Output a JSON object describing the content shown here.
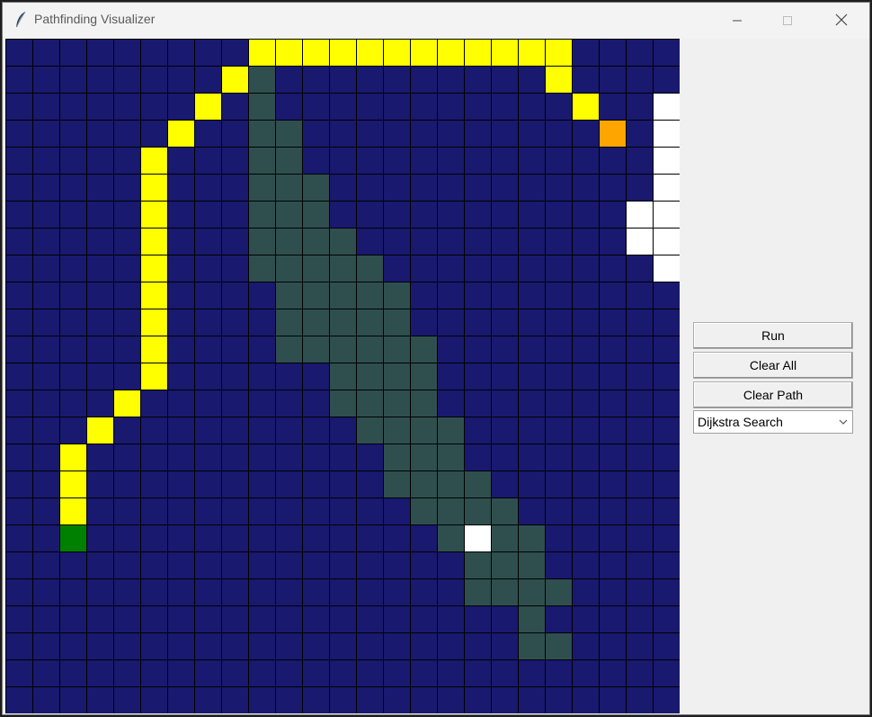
{
  "window": {
    "title": "Pathfinding Visualizer"
  },
  "controls": {
    "run_label": "Run",
    "clear_all_label": "Clear All",
    "clear_path_label": "Clear Path",
    "algorithm_selected": "Dijkstra Search",
    "icons": [
      "feather-icon",
      "minimize-icon",
      "maximize-icon",
      "close-icon",
      "chevron-down-icon"
    ]
  },
  "colors": {
    "empty": "#191970",
    "path": "#ffff00",
    "explored": "#2f4f4f",
    "wall": "#ffffff",
    "start": "#008000",
    "end": "#ffa500",
    "grid_line": "#000000"
  },
  "grid": {
    "rows": 25,
    "cols": 25,
    "cells": [
      "000000000yyyyyyyyyyyy0000",
      "00000000yx0000000000y0000",
      "0000000y0x00000000000y00w",
      "000000y00xx0000000000000w",
      "00000y000xx0000000000000ww",
      "00000y000xxx000000000000ww",
      "00000y000xxx00000000000www",
      "00000y000xxxx0000000000www",
      "00000y000xxxxx0000000000w",
      "00000y0000xxxxx0000000000",
      "00000y0000xxxxx0000000000",
      "00000y0000xxxxxx000000000",
      "00000y000000xxxx000000000",
      "0000y0000000xxxx000000000",
      "000y000000000xxxx00000000",
      "00y00000000000xxx00000000",
      "00y00000000000xxxx0000000",
      "00y000000000000xxxx000000",
      "00s0000000000000xwxx00000",
      "00000000000000000xxx00000",
      "00000000000000000xxxx0000",
      "0000000000000000000x00000",
      "0000000000000000000xx0000",
      "0000000000000000000000000",
      "0000000000000000000000000"
    ],
    "end_cell": [
      3,
      22
    ]
  }
}
